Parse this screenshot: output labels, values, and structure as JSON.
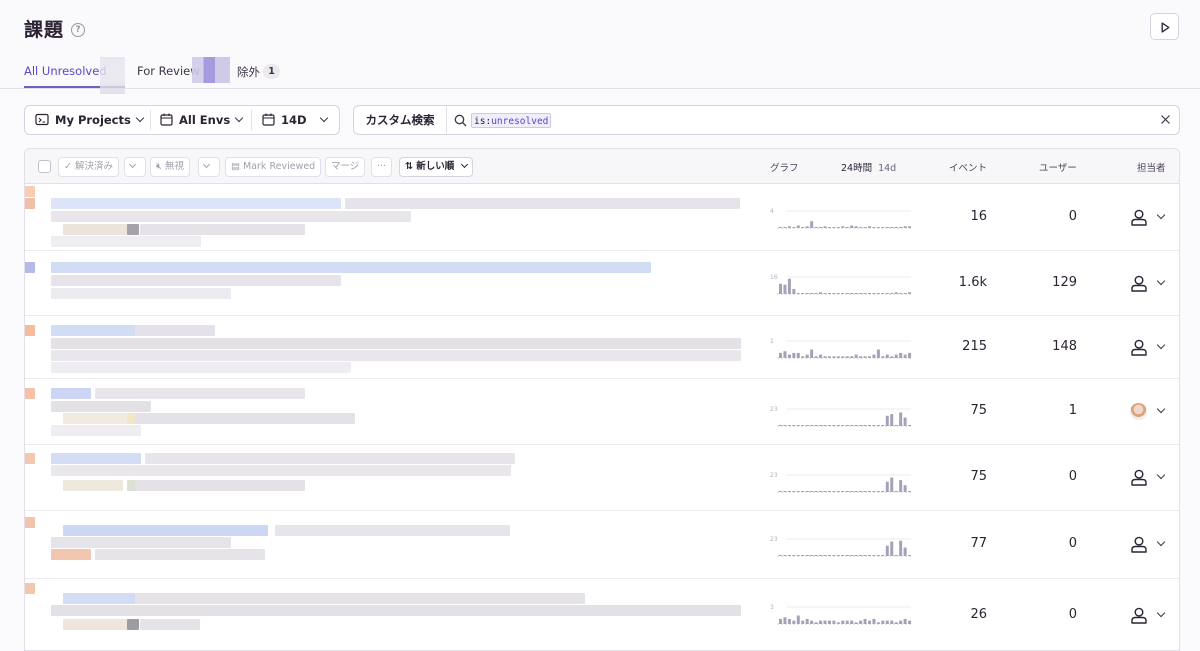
{
  "page": {
    "title": "課題",
    "help_icon": "?"
  },
  "tabs": [
    {
      "label": "All Unresolved",
      "active": true
    },
    {
      "label": "For Review",
      "active": false
    },
    {
      "label": "除外",
      "badge": "1",
      "active": false
    }
  ],
  "filters": {
    "projects": "My Projects",
    "envs": "All Envs",
    "period": "14D"
  },
  "search": {
    "label": "カスタム検索",
    "token_key": "is",
    "token_value": "unresolved"
  },
  "actions": {
    "resolve": "解決済み",
    "ignore": "無視",
    "mark_reviewed": "Mark Reviewed",
    "merge": "マージ",
    "more": "···",
    "sort": "新しい順"
  },
  "columns": {
    "graph": "グラフ",
    "period_24h": "24時間",
    "period_14d": "14d",
    "events": "イベント",
    "users": "ユーザー",
    "assignee": "担当者"
  },
  "colors": {
    "accent": "#6c5fc7",
    "bar": "#a6a1b8"
  },
  "issues": [
    {
      "events": "16",
      "users": "0",
      "tick": "4",
      "assigned": false,
      "spark": [
        0.05,
        0.05,
        0.1,
        0.05,
        0.15,
        0.05,
        0.1,
        0.4,
        0.05,
        0.05,
        0.1,
        0.05,
        0.05,
        0.05,
        0.1,
        0.05,
        0.15,
        0.1,
        0.05,
        0.05,
        0.1,
        0.05,
        0.05,
        0.05,
        0.05,
        0.05,
        0.05,
        0.05,
        0.1,
        0.1
      ]
    },
    {
      "events": "1.6k",
      "users": "129",
      "tick": "16",
      "assigned": false,
      "spark": [
        0.6,
        0.55,
        0.9,
        0.3,
        0,
        0,
        0.05,
        0,
        0,
        0.1,
        0,
        0,
        0,
        0.05,
        0,
        0,
        0,
        0,
        0.05,
        0,
        0,
        0,
        0,
        0,
        0,
        0,
        0.1,
        0,
        0,
        0.1
      ]
    },
    {
      "events": "215",
      "users": "148",
      "tick": "1",
      "assigned": false,
      "spark": [
        0.3,
        0.4,
        0.2,
        0.3,
        0.3,
        0.1,
        0.2,
        0.5,
        0.1,
        0.2,
        0.1,
        0.1,
        0.1,
        0.1,
        0.1,
        0.1,
        0.1,
        0.2,
        0.1,
        0.1,
        0.1,
        0.2,
        0.5,
        0.1,
        0.2,
        0.1,
        0.2,
        0.3,
        0.2,
        0.3
      ]
    },
    {
      "events": "75",
      "users": "1",
      "tick": "23",
      "assigned": true,
      "spark": [
        0,
        0,
        0,
        0,
        0,
        0,
        0,
        0,
        0,
        0,
        0,
        0,
        0,
        0,
        0,
        0,
        0,
        0,
        0,
        0,
        0,
        0,
        0,
        0,
        0.6,
        0.7,
        0,
        0.8,
        0.5,
        0
      ]
    },
    {
      "events": "75",
      "users": "0",
      "tick": "23",
      "assigned": false,
      "spark": [
        0,
        0,
        0,
        0,
        0,
        0,
        0,
        0,
        0,
        0,
        0,
        0,
        0,
        0,
        0,
        0,
        0,
        0,
        0,
        0,
        0,
        0,
        0,
        0,
        0.6,
        0.85,
        0,
        0.7,
        0.4,
        0
      ]
    },
    {
      "events": "77",
      "users": "0",
      "tick": "23",
      "assigned": false,
      "spark": [
        0,
        0,
        0,
        0,
        0,
        0,
        0,
        0,
        0,
        0,
        0,
        0,
        0,
        0,
        0,
        0,
        0,
        0,
        0,
        0,
        0,
        0,
        0,
        0,
        0.6,
        0.85,
        0,
        0.9,
        0.5,
        0
      ]
    },
    {
      "events": "26",
      "users": "0",
      "tick": "3",
      "assigned": false,
      "spark": [
        0.3,
        0.4,
        0.3,
        0.2,
        0.5,
        0.2,
        0.3,
        0.2,
        0.1,
        0.2,
        0.2,
        0.2,
        0.2,
        0.1,
        0.2,
        0.2,
        0.2,
        0.1,
        0.2,
        0.3,
        0.2,
        0.3,
        0.1,
        0.2,
        0.2,
        0.2,
        0.1,
        0.2,
        0.3,
        0.2
      ]
    }
  ]
}
